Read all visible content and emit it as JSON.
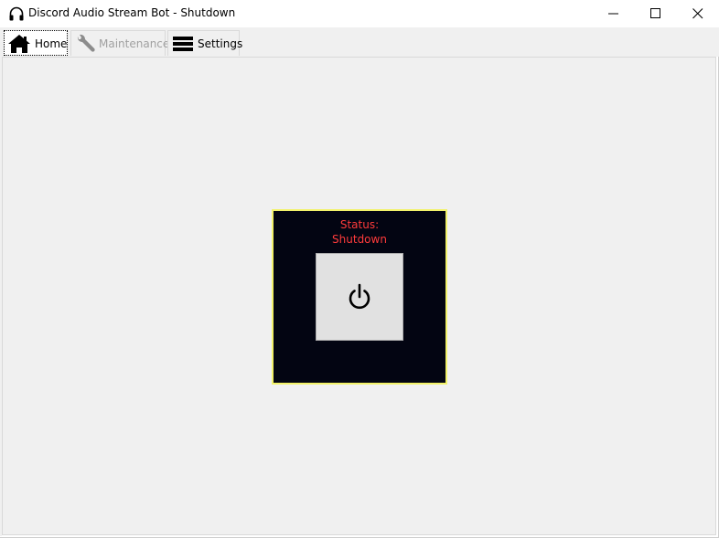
{
  "window": {
    "title": "Discord Audio Stream Bot - Shutdown",
    "app_icon": "headphones-icon",
    "controls": [
      "minimize-icon",
      "maximize-icon",
      "close-icon"
    ]
  },
  "tabs": [
    {
      "label": "Home",
      "icon": "home-icon",
      "selected": true,
      "enabled": true
    },
    {
      "label": "Maintenance",
      "icon": "wrench-icon",
      "selected": false,
      "enabled": false
    },
    {
      "label": "Settings",
      "icon": "menu-lines-icon",
      "selected": false,
      "enabled": true
    }
  ],
  "status": {
    "title": "Status:",
    "value": "Shutdown",
    "value_color": "#ff3b3b",
    "border_color": "#f2f26a",
    "background_color": "#030512",
    "button_icon": "power-icon"
  }
}
